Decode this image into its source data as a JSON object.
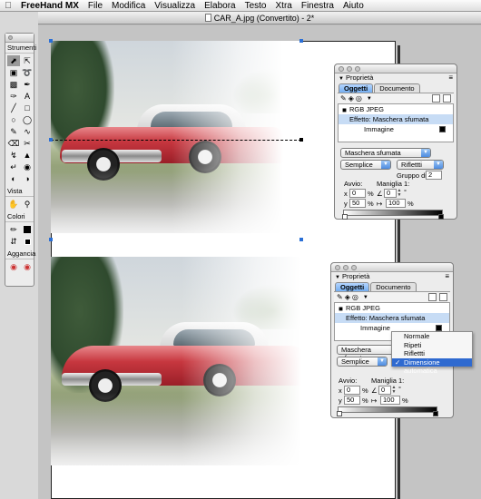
{
  "menubar": {
    "app_name": "FreeHand MX",
    "items": [
      "File",
      "Modifica",
      "Visualizza",
      "Elabora",
      "Testo",
      "Xtra",
      "Finestra",
      "Aiuto"
    ]
  },
  "document": {
    "title": "CAR_A.jpg (Convertito) - 2*"
  },
  "tools": {
    "section_tools": "Strumenti",
    "section_view": "Vista",
    "section_colors": "Colori",
    "section_snap": "Aggancia"
  },
  "panel_top": {
    "title": "Proprietà",
    "tab_objects": "Oggetti",
    "tab_document": "Documento",
    "list": [
      "RGB JPEG",
      "Effetto: Maschera sfumata",
      "Immagine"
    ],
    "effect_select": "Maschera sfumata",
    "blend_select": "Semplice",
    "mode_select": "Riflettti",
    "group_label": "Gruppo di",
    "group_value": "2",
    "start_label": "Avvio:",
    "handle_label": "Maniglia 1:",
    "x_label": "x",
    "x_value": "0",
    "y_label": "y",
    "y_value": "50",
    "percent": "%",
    "angle_value": "0",
    "length_value": "100",
    "degree": "°"
  },
  "panel_bottom": {
    "title": "Proprietà",
    "tab_objects": "Oggetti",
    "tab_document": "Documento",
    "list": [
      "RGB JPEG",
      "Effetto: Maschera sfumata",
      "Immagine"
    ],
    "effect_select": "Maschera sfumata",
    "blend_select": "Semplice",
    "start_label": "Avvio:",
    "handle_label": "Maniglia 1:",
    "x_label": "x",
    "x_value": "0",
    "y_label": "y",
    "y_value": "50",
    "percent": "%",
    "angle_value": "0",
    "length_value": "100",
    "degree": "°"
  },
  "dropdown": {
    "options": [
      "Normale",
      "Ripeti",
      "Riflettti",
      "Dimensione automatica"
    ],
    "selected_index": 3,
    "check_mark": "✓"
  },
  "colors": {
    "selection_blue": "#2f6ad0",
    "tab_active": "#74aef0",
    "list_selected": "#c7dcf5"
  }
}
